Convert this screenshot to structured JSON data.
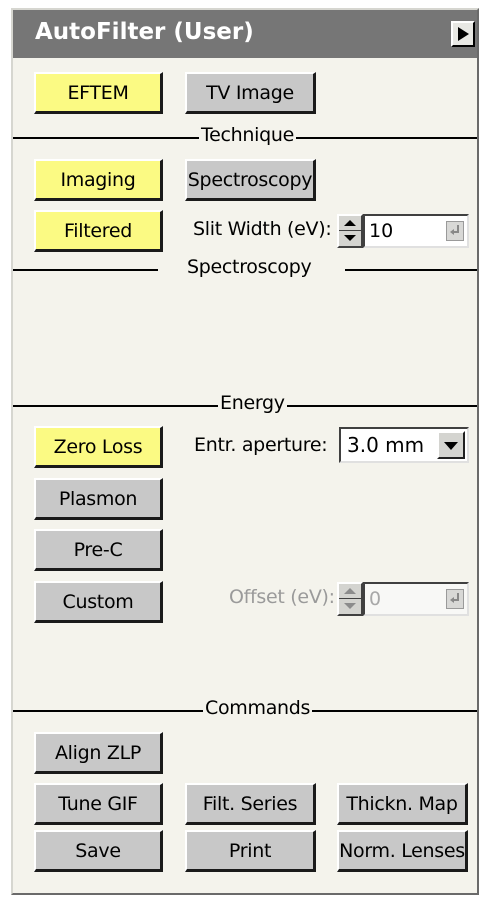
{
  "window": {
    "title": "AutoFilter (User)",
    "menu_icon": "triangle-right-icon"
  },
  "mode": {
    "eftem_label": "EFTEM",
    "tv_image_label": "TV Image"
  },
  "technique": {
    "section_label": "Technique",
    "imaging_label": "Imaging",
    "spectroscopy_label": "Spectroscopy",
    "filtered_label": "Filtered",
    "slit_width_label": "Slit Width (eV):",
    "slit_width_value": "10"
  },
  "spectroscopy": {
    "section_label": "Spectroscopy"
  },
  "energy": {
    "section_label": "Energy",
    "zero_loss_label": "Zero Loss",
    "plasmon_label": "Plasmon",
    "pre_c_label": "Pre-C",
    "custom_label": "Custom",
    "entrance_aperture_label": "Entr. aperture:",
    "entrance_aperture_value": "3.0 mm",
    "offset_label": "Offset (eV):",
    "offset_value": "0"
  },
  "commands": {
    "section_label": "Commands",
    "align_zlp_label": "Align ZLP",
    "tune_gif_label": "Tune GIF",
    "filt_series_label": "Filt. Series",
    "thickn_map_label": "Thickn. Map",
    "save_label": "Save",
    "print_label": "Print",
    "norm_lenses_label": "Norm. Lenses"
  },
  "colors": {
    "active_button": "#fbfa83",
    "inactive_button": "#c8c8c8",
    "title_bar": "#767676",
    "panel_background": "#f4f3ec"
  }
}
